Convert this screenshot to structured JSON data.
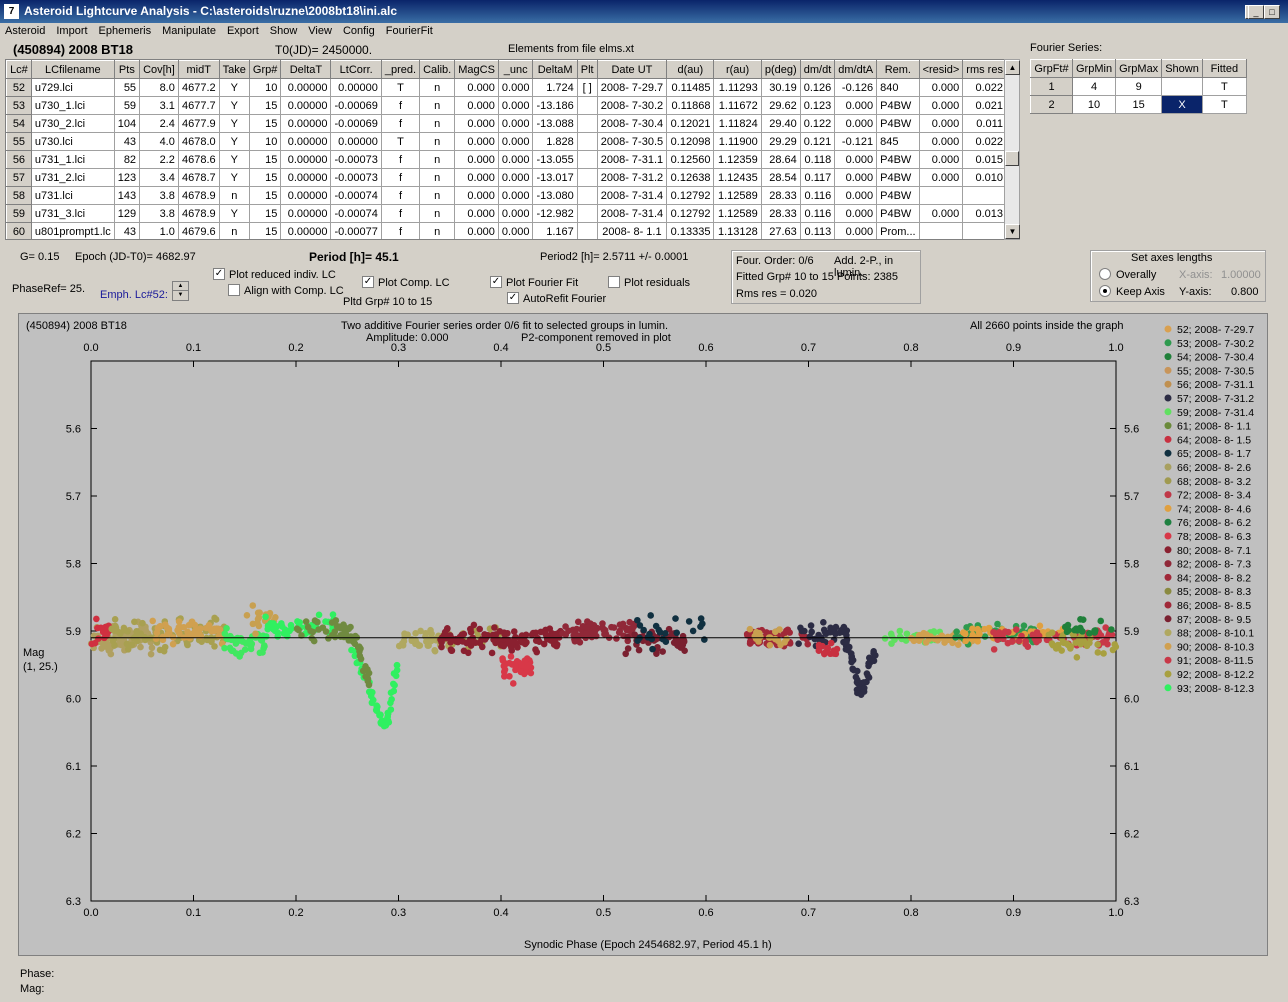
{
  "window": {
    "title": "Asteroid Lightcurve Analysis - C:\\asteroids\\ruzne\\2008bt18\\ini.alc",
    "min": "_",
    "max": "□",
    "close": "X",
    "app_icon": "7"
  },
  "menu": [
    "Asteroid",
    "Import",
    "Ephemeris",
    "Manipulate",
    "Export",
    "Show",
    "View",
    "Config",
    "FourierFit"
  ],
  "header": {
    "asteroid": "(450894) 2008 BT18",
    "t0": "T0(JD)= 2450000.",
    "elements": "Elements from file elms.xt"
  },
  "lc_table": {
    "columns": [
      "Lc#",
      "LCfilename",
      "Pts",
      "Cov[h]",
      "midT",
      "Take",
      "Grp#",
      "DeltaT",
      "LtCorr.",
      "_pred.",
      "Calib.",
      "MagCS",
      "_unc",
      "DeltaM",
      "Plt",
      "Date UT",
      "d(au)",
      "r(au)",
      "p(deg)",
      "dm/dt",
      "dm/dtA",
      "Rem.",
      "<resid>",
      "rms res"
    ],
    "rows": [
      [
        "52",
        "u729.lci",
        "55",
        "8.0",
        "4677.2",
        "Y",
        "10",
        "0.00000",
        "0.00000",
        "T",
        "n",
        "0.000",
        "0.000",
        "1.724",
        "[ ]",
        "2008- 7-29.7",
        "0.11485",
        "1.11293",
        "30.19",
        "0.126",
        "-0.126",
        "840",
        "0.000",
        "0.022"
      ],
      [
        "53",
        "u730_1.lci",
        "59",
        "3.1",
        "4677.7",
        "Y",
        "15",
        "0.00000",
        "-0.00069",
        "f",
        "n",
        "0.000",
        "0.000",
        "-13.186",
        "",
        "2008- 7-30.2",
        "0.11868",
        "1.11672",
        "29.62",
        "0.123",
        "0.000",
        "P4BW",
        "0.000",
        "0.021"
      ],
      [
        "54",
        "u730_2.lci",
        "104",
        "2.4",
        "4677.9",
        "Y",
        "15",
        "0.00000",
        "-0.00069",
        "f",
        "n",
        "0.000",
        "0.000",
        "-13.088",
        "",
        "2008- 7-30.4",
        "0.12021",
        "1.11824",
        "29.40",
        "0.122",
        "0.000",
        "P4BW",
        "0.000",
        "0.011"
      ],
      [
        "55",
        "u730.lci",
        "43",
        "4.0",
        "4678.0",
        "Y",
        "10",
        "0.00000",
        "0.00000",
        "T",
        "n",
        "0.000",
        "0.000",
        "1.828",
        "",
        "2008- 7-30.5",
        "0.12098",
        "1.11900",
        "29.29",
        "0.121",
        "-0.121",
        "845",
        "0.000",
        "0.022"
      ],
      [
        "56",
        "u731_1.lci",
        "82",
        "2.2",
        "4678.6",
        "Y",
        "15",
        "0.00000",
        "-0.00073",
        "f",
        "n",
        "0.000",
        "0.000",
        "-13.055",
        "",
        "2008- 7-31.1",
        "0.12560",
        "1.12359",
        "28.64",
        "0.118",
        "0.000",
        "P4BW",
        "0.000",
        "0.015"
      ],
      [
        "57",
        "u731_2.lci",
        "123",
        "3.4",
        "4678.7",
        "Y",
        "15",
        "0.00000",
        "-0.00073",
        "f",
        "n",
        "0.000",
        "0.000",
        "-13.017",
        "",
        "2008- 7-31.2",
        "0.12638",
        "1.12435",
        "28.54",
        "0.117",
        "0.000",
        "P4BW",
        "0.000",
        "0.010"
      ],
      [
        "58",
        "u731.lci",
        "143",
        "3.8",
        "4678.9",
        "n",
        "15",
        "0.00000",
        "-0.00074",
        "f",
        "n",
        "0.000",
        "0.000",
        "-13.080",
        "",
        "2008- 7-31.4",
        "0.12792",
        "1.12589",
        "28.33",
        "0.116",
        "0.000",
        "P4BW",
        "",
        ""
      ],
      [
        "59",
        "u731_3.lci",
        "129",
        "3.8",
        "4678.9",
        "Y",
        "15",
        "0.00000",
        "-0.00074",
        "f",
        "n",
        "0.000",
        "0.000",
        "-12.982",
        "",
        "2008- 7-31.4",
        "0.12792",
        "1.12589",
        "28.33",
        "0.116",
        "0.000",
        "P4BW",
        "0.000",
        "0.013"
      ],
      [
        "60",
        "u801prompt1.lc",
        "43",
        "1.0",
        "4679.6",
        "n",
        "15",
        "0.00000",
        "-0.00077",
        "f",
        "n",
        "0.000",
        "0.000",
        "1.167",
        "",
        "2008- 8- 1.1",
        "0.13335",
        "1.13128",
        "27.63",
        "0.113",
        "0.000",
        "Prom...",
        "",
        ""
      ]
    ]
  },
  "fourier_series": {
    "label": "Fourier Series:",
    "columns": [
      "GrpFt#",
      "GrpMin",
      "GrpMax",
      "Shown",
      "Fitted"
    ],
    "rows": [
      [
        "1",
        "4",
        "9",
        "",
        "T"
      ],
      [
        "2",
        "10",
        "15",
        "X",
        "T"
      ]
    ]
  },
  "controls": {
    "g": "G= 0.15",
    "epoch": "Epoch (JD-T0)= 4682.97",
    "period": "Period [h]= 45.1",
    "period2": "Period2 [h]= 2.5711 +/- 0.0001",
    "phaseref": "PhaseRef= 25.",
    "emph": "Emph. Lc#52:",
    "plot_reduced": "Plot reduced indiv. LC",
    "align_comp": "Align with Comp. LC",
    "plot_comp": "Plot Comp. LC",
    "pltd_grp": "Pltd Grp#  10 to   15",
    "plot_fourier": "Plot Fourier Fit",
    "plot_residuals": "Plot residuals",
    "autorefit": "AutoRefit Fourier",
    "check_mark": "✓"
  },
  "fit_info": {
    "order": "Four. Order:  0/6",
    "add": "Add. 2-P., in lumin.",
    "fitted": "Fitted Grp# 10 to 15 Points: 2385",
    "rms": "Rms res      = 0.020"
  },
  "axes_box": {
    "title": "Set axes lengths",
    "overally": "Overally",
    "keep": "Keep Axis",
    "x_label": "X-axis:",
    "x_val": "1.00000",
    "y_label": "Y-axis:",
    "y_val": "0.800"
  },
  "plot": {
    "name": "(450894) 2008 BT18",
    "title1": "Two additive Fourier series order 0/6 fit to selected groups in lumin.",
    "title2a": "Amplitude: 0.000",
    "title2b": "P2-component removed in plot",
    "inside": "All 2660 points inside the graph",
    "xlabel": "Synodic Phase (Epoch 2454682.97, Period 45.1 h)",
    "ylabel1": "Mag",
    "ylabel2": "(1, 25.)"
  },
  "chart_data": {
    "type": "scatter",
    "xlim": [
      0,
      1
    ],
    "ylim": [
      5.5,
      6.3
    ],
    "y_inverted": true,
    "x_ticks": [
      "0.0",
      "0.1",
      "0.2",
      "0.3",
      "0.4",
      "0.5",
      "0.6",
      "0.7",
      "0.8",
      "0.9",
      "1.0"
    ],
    "y_ticks": [
      "5.6",
      "5.7",
      "5.8",
      "5.9",
      "6.0",
      "6.1",
      "6.2",
      "6.3"
    ],
    "fit_line_y": 5.91,
    "legend": [
      {
        "label": "52; 2008- 7-29.7",
        "color": "#d9a050"
      },
      {
        "label": "53; 2008- 7-30.2",
        "color": "#2e9a4e"
      },
      {
        "label": "54; 2008- 7-30.4",
        "color": "#20803a"
      },
      {
        "label": "55; 2008- 7-30.5",
        "color": "#c8955a"
      },
      {
        "label": "56; 2008- 7-31.1",
        "color": "#c09050"
      },
      {
        "label": "57; 2008- 7-31.2",
        "color": "#2c2c44"
      },
      {
        "label": "59; 2008- 7-31.4",
        "color": "#60e060"
      },
      {
        "label": "61; 2008- 8- 1.1",
        "color": "#6a8a3a"
      },
      {
        "label": "64; 2008- 8- 1.5",
        "color": "#c83040"
      },
      {
        "label": "65; 2008- 8- 1.7",
        "color": "#103040"
      },
      {
        "label": "66; 2008- 8- 2.6",
        "color": "#a8a060"
      },
      {
        "label": "68; 2008- 8- 3.2",
        "color": "#a09a50"
      },
      {
        "label": "72; 2008- 8- 3.4",
        "color": "#c03848"
      },
      {
        "label": "74; 2008- 8- 4.6",
        "color": "#e0a040"
      },
      {
        "label": "76; 2008- 8- 6.2",
        "color": "#1e8040"
      },
      {
        "label": "78; 2008- 8- 6.3",
        "color": "#d83848"
      },
      {
        "label": "80; 2008- 8- 7.1",
        "color": "#8a2030"
      },
      {
        "label": "82; 2008- 8- 7.3",
        "color": "#902838"
      },
      {
        "label": "84; 2008- 8- 8.2",
        "color": "#a02838"
      },
      {
        "label": "85; 2008- 8- 8.3",
        "color": "#8a8a40"
      },
      {
        "label": "86; 2008- 8- 8.5",
        "color": "#a02838"
      },
      {
        "label": "87; 2008- 8- 9.5",
        "color": "#7a2030"
      },
      {
        "label": "88; 2008- 8-10.1",
        "color": "#b0a860"
      },
      {
        "label": "90; 2008- 8-10.3",
        "color": "#d0a050"
      },
      {
        "label": "91; 2008- 8-11.5",
        "color": "#c83848"
      },
      {
        "label": "92; 2008- 8-12.2",
        "color": "#a8a040"
      },
      {
        "label": "93; 2008- 8-12.3",
        "color": "#30f060"
      }
    ],
    "segments": [
      {
        "x0": 0.0,
        "x1": 0.06,
        "y": 5.91,
        "spread": 0.035,
        "color": "#b0a060",
        "n": 70
      },
      {
        "x0": 0.0,
        "x1": 0.02,
        "y": 5.91,
        "spread": 0.04,
        "color": "#d03040",
        "n": 15
      },
      {
        "x0": 0.02,
        "x1": 0.13,
        "y": 5.905,
        "spread": 0.035,
        "color": "#a8a050",
        "n": 90
      },
      {
        "x0": 0.06,
        "x1": 0.13,
        "y": 5.9,
        "spread": 0.03,
        "color": "#d0a050",
        "n": 50
      },
      {
        "x0": 0.13,
        "x1": 0.17,
        "y": 5.92,
        "spread": 0.035,
        "color": "#40e860",
        "n": 45
      },
      {
        "x0": 0.15,
        "x1": 0.18,
        "y": 5.88,
        "spread": 0.03,
        "color": "#c8a050",
        "n": 20
      },
      {
        "x0": 0.17,
        "x1": 0.24,
        "y": 5.895,
        "spread": 0.025,
        "color": "#30f060",
        "n": 55
      },
      {
        "x0": 0.2,
        "x1": 0.26,
        "y": 5.9,
        "spread": 0.03,
        "color": "#708a40",
        "n": 30
      },
      {
        "x0": 0.3,
        "x1": 0.35,
        "y": 5.915,
        "spread": 0.025,
        "color": "#b0a860",
        "n": 40
      },
      {
        "x0": 0.34,
        "x1": 0.4,
        "y": 5.91,
        "spread": 0.025,
        "color": "#a8a050",
        "n": 35
      },
      {
        "x0": 0.34,
        "x1": 0.46,
        "y": 5.91,
        "spread": 0.03,
        "color": "#8a2030",
        "n": 120
      },
      {
        "x0": 0.4,
        "x1": 0.43,
        "y": 5.955,
        "spread": 0.03,
        "color": "#d83848",
        "n": 45
      },
      {
        "x0": 0.46,
        "x1": 0.53,
        "y": 5.9,
        "spread": 0.025,
        "color": "#902838",
        "n": 70
      },
      {
        "x0": 0.52,
        "x1": 0.58,
        "y": 5.915,
        "spread": 0.025,
        "color": "#7a2030",
        "n": 45
      },
      {
        "x0": 0.53,
        "x1": 0.6,
        "y": 5.9,
        "spread": 0.04,
        "color": "#103040",
        "n": 25
      },
      {
        "x0": 0.64,
        "x1": 0.7,
        "y": 5.91,
        "spread": 0.02,
        "color": "#a02838",
        "n": 50
      },
      {
        "x0": 0.64,
        "x1": 0.68,
        "y": 5.91,
        "spread": 0.02,
        "color": "#c8a050",
        "n": 20
      },
      {
        "x0": 0.69,
        "x1": 0.74,
        "y": 5.905,
        "spread": 0.025,
        "color": "#2c2c44",
        "n": 35
      },
      {
        "x0": 0.71,
        "x1": 0.73,
        "y": 5.93,
        "spread": 0.02,
        "color": "#c83040",
        "n": 15
      },
      {
        "x0": 0.77,
        "x1": 0.83,
        "y": 5.91,
        "spread": 0.02,
        "color": "#60e060",
        "n": 25
      },
      {
        "x0": 0.8,
        "x1": 0.86,
        "y": 5.91,
        "spread": 0.02,
        "color": "#d0a050",
        "n": 35
      },
      {
        "x0": 0.84,
        "x1": 0.92,
        "y": 5.905,
        "spread": 0.025,
        "color": "#2e9a4e",
        "n": 50
      },
      {
        "x0": 0.85,
        "x1": 0.95,
        "y": 5.905,
        "spread": 0.02,
        "color": "#e0a040",
        "n": 45
      },
      {
        "x0": 0.88,
        "x1": 1.0,
        "y": 5.91,
        "spread": 0.025,
        "color": "#c83848",
        "n": 60
      },
      {
        "x0": 0.93,
        "x1": 1.0,
        "y": 5.92,
        "spread": 0.03,
        "color": "#a8a040",
        "n": 35
      },
      {
        "x0": 0.95,
        "x1": 1.0,
        "y": 5.895,
        "spread": 0.02,
        "color": "#20803a",
        "n": 20
      }
    ],
    "curves": [
      {
        "color": "#30f060",
        "points": [
          [
            0.255,
            5.93
          ],
          [
            0.265,
            5.96
          ],
          [
            0.275,
            6.0
          ],
          [
            0.28,
            6.02
          ],
          [
            0.285,
            6.04
          ],
          [
            0.29,
            6.03
          ],
          [
            0.295,
            5.98
          ],
          [
            0.3,
            5.94
          ]
        ]
      },
      {
        "color": "#2c2c44",
        "points": [
          [
            0.735,
            5.91
          ],
          [
            0.74,
            5.93
          ],
          [
            0.745,
            5.96
          ],
          [
            0.75,
            5.99
          ],
          [
            0.755,
            5.98
          ],
          [
            0.76,
            5.95
          ],
          [
            0.765,
            5.93
          ]
        ]
      },
      {
        "color": "#708a40",
        "points": [
          [
            0.24,
            5.89
          ],
          [
            0.25,
            5.9
          ],
          [
            0.26,
            5.92
          ],
          [
            0.268,
            5.96
          ],
          [
            0.272,
            5.98
          ]
        ]
      }
    ]
  },
  "status": {
    "phase": "Phase:",
    "mag": "Mag:"
  }
}
